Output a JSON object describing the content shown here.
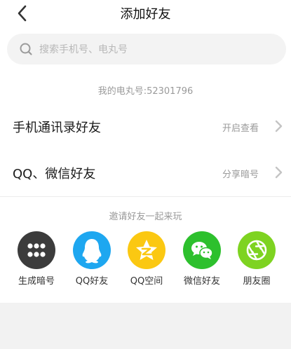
{
  "header": {
    "title": "添加好友"
  },
  "search": {
    "placeholder": "搜索手机号、电丸号",
    "value": ""
  },
  "my_number": "我的电丸号:52301796",
  "rows": [
    {
      "label": "手机通讯录好友",
      "action": "开启查看"
    },
    {
      "label": "QQ、微信好友",
      "action": "分享暗号"
    }
  ],
  "invite": {
    "title": "邀请好友一起来玩",
    "items": [
      {
        "label": "生成暗号",
        "icon": "dots-grid-icon",
        "color": "#3c3c3c"
      },
      {
        "label": "QQ好友",
        "icon": "qq-penguin-icon",
        "color": "#1ea7f0"
      },
      {
        "label": "QQ空间",
        "icon": "qzone-star-icon",
        "color": "#fbc812"
      },
      {
        "label": "微信好友",
        "icon": "wechat-icon",
        "color": "#2dc02d"
      },
      {
        "label": "朋友圈",
        "icon": "moments-aperture-icon",
        "color": "#7ed321"
      }
    ]
  },
  "colors": {
    "search_bg": "#f3f3f3",
    "secondary_text": "#9a9a9a",
    "bottom_bg": "#f2f2f2"
  }
}
